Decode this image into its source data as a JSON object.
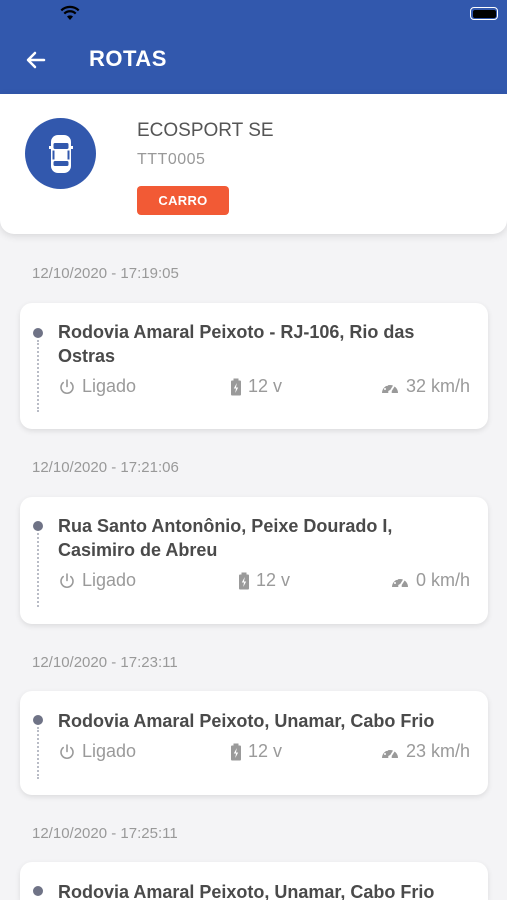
{
  "header": {
    "title": "ROTAS"
  },
  "vehicle": {
    "name": "ECOSPORT SE",
    "plate": "TTT0005",
    "type": "CARRO"
  },
  "routes": [
    {
      "timestamp": "12/10/2020 - 17:19:05",
      "address_line1": "Rodovia Amaral Peixoto - RJ-106, Rio das",
      "address_line2": "Ostras",
      "status": "Ligado",
      "voltage": "12 v",
      "speed": "32 km/h"
    },
    {
      "timestamp": "12/10/2020 - 17:21:06",
      "address_line1": "Rua Santo Antonônio, Peixe Dourado I,",
      "address_line2": "Casimiro de Abreu",
      "status": "Ligado",
      "voltage": "12 v",
      "speed": "0 km/h"
    },
    {
      "timestamp": "12/10/2020 - 17:23:11",
      "address_line1": "Rodovia Amaral Peixoto, Unamar, Cabo Frio",
      "status": "Ligado",
      "voltage": "12 v",
      "speed": "23 km/h"
    },
    {
      "timestamp": "12/10/2020 - 17:25:11",
      "address_line1": "Rodovia Amaral Peixoto, Unamar, Cabo Frio"
    }
  ],
  "icons": {
    "back": "arrow-left-icon",
    "vehicle": "car-icon",
    "status": "power-icon",
    "voltage": "battery-icon",
    "speed": "speedometer-icon"
  }
}
